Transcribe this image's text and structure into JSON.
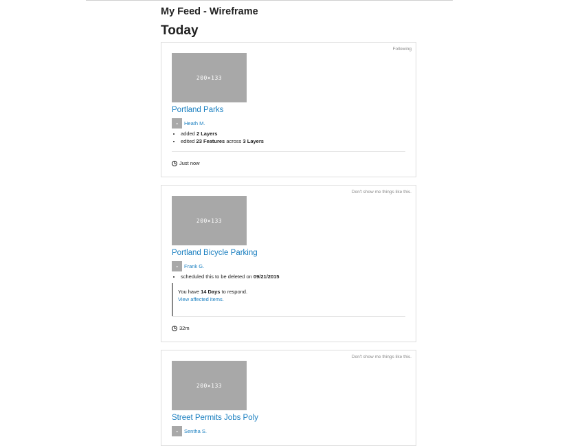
{
  "page": {
    "title": "My Feed - Wireframe",
    "section": "Today"
  },
  "cards": [
    {
      "tag": "Following",
      "thumb": "200×133",
      "title": "Portland Parks",
      "avatar_text": "15",
      "author": "Heath M.",
      "actions": [
        {
          "pre": "added ",
          "b1": "2 Layers",
          "mid": "",
          "b2": ""
        },
        {
          "pre": "edited ",
          "b1": "23 Features",
          "mid": " across ",
          "b2": "3 Layers"
        }
      ],
      "time": "Just now"
    },
    {
      "tag": "Don't show me things like this.",
      "thumb": "200×133",
      "title": "Portland Bicycle Parking",
      "avatar_text": "15",
      "author": "Frank G.",
      "actions": [
        {
          "pre": "scheduled this to be deleted on ",
          "b1": "09/21/2015",
          "mid": "",
          "b2": ""
        }
      ],
      "notice": {
        "pre": "You have ",
        "bold": "14 Days",
        "post": " to respond.",
        "link": "View affected items."
      },
      "time": "32m"
    },
    {
      "tag": "Don't show me things like this.",
      "thumb": "200×133",
      "title": "Street Permits Jobs Poly",
      "avatar_text": "15",
      "author": "Sentha S."
    }
  ]
}
